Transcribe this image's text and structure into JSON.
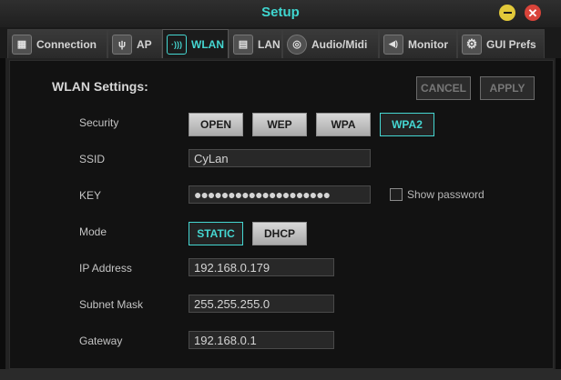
{
  "window": {
    "title": "Setup"
  },
  "tabs": [
    {
      "label": "Connection",
      "icon": "grid-icon",
      "glyph": "▦"
    },
    {
      "label": "AP",
      "icon": "antenna-icon",
      "glyph": "ψ"
    },
    {
      "label": "WLAN",
      "icon": "wifi-icon",
      "glyph": "·)))"
    },
    {
      "label": "LAN",
      "icon": "network-port-icon",
      "glyph": "▤"
    },
    {
      "label": "Audio/Midi",
      "icon": "midi-connector-icon",
      "glyph": "◎"
    },
    {
      "label": "Monitor",
      "icon": "speaker-icon",
      "glyph": "◀)"
    },
    {
      "label": "GUI Prefs",
      "icon": "gears-icon",
      "glyph": "⚙"
    }
  ],
  "settings": {
    "title": "WLAN Settings:",
    "cancel_label": "CANCEL",
    "apply_label": "APPLY"
  },
  "form": {
    "security": {
      "label": "Security",
      "options": [
        "OPEN",
        "WEP",
        "WPA",
        "WPA2"
      ],
      "selected": "WPA2"
    },
    "ssid": {
      "label": "SSID",
      "value": "CyLan"
    },
    "key": {
      "label": "KEY",
      "value": "●●●●●●●●●●●●●●●●●●●●",
      "show_password_label": "Show password",
      "show_password_checked": false
    },
    "mode": {
      "label": "Mode",
      "options": [
        "STATIC",
        "DHCP"
      ],
      "selected": "STATIC"
    },
    "ip_address": {
      "label": "IP Address",
      "value": "192.168.0.179"
    },
    "subnet_mask": {
      "label": "Subnet Mask",
      "value": "255.255.255.0"
    },
    "gateway": {
      "label": "Gateway",
      "value": "192.168.0.1"
    }
  },
  "colors": {
    "accent": "#45d7d2",
    "title": "#3fd6d0",
    "minimize": "#e2c93a",
    "close": "#d9443a"
  }
}
